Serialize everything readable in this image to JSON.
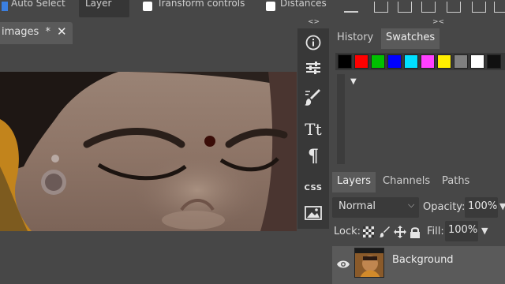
{
  "top_options": {
    "transform_select": "Layer",
    "item_partial_left": "Auto Select",
    "item_transform": "Transform controls",
    "item_distances": "Distances"
  },
  "document": {
    "tab_name": "images",
    "modified_mark": "*"
  },
  "tools": [
    "info-icon",
    "adjustments-icon",
    "brush-icon",
    "text-icon",
    "paragraph-icon",
    "css-icon",
    "image-icon"
  ],
  "tool_labels": {
    "text": "Tt",
    "paragraph": "¶",
    "css": "CSS"
  },
  "collapse": {
    "left": "<>",
    "right": "><"
  },
  "swatch_panel": {
    "tabs": [
      "History",
      "Swatches"
    ],
    "active_tab": "Swatches",
    "colors": [
      "#000000",
      "#ff0000",
      "#00c000",
      "#0000ff",
      "#00e0ff",
      "#ff40ff",
      "#ffee00",
      "#808080",
      "#ffffff",
      "#101010"
    ],
    "expand_glyph": "▼"
  },
  "layers_panel": {
    "tabs": [
      "Layers",
      "Channels",
      "Paths"
    ],
    "active_tab": "Layers",
    "blend_mode": "Normal",
    "opacity_label": "Opacity:",
    "opacity_value": "100%",
    "lock_label": "Lock:",
    "fill_label": "Fill:",
    "fill_value": "100%",
    "layer_name": "Background"
  },
  "colors": {
    "panel_bg": "#474747",
    "dark_bg": "#383838",
    "active_tab": "#5a5a5a"
  }
}
